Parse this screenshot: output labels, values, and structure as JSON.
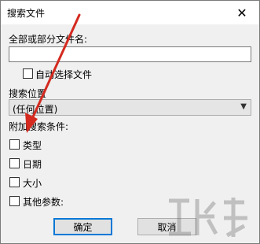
{
  "window": {
    "title": "搜索文件",
    "close_glyph": "✕"
  },
  "name_label": "全部或部分文件名:",
  "name_value": "",
  "auto_select_label": "自动选择文件",
  "location_label": "搜索位置",
  "location_value": "(任何位置)",
  "extra_label": "附加搜索条件:",
  "criteria": [
    "类型",
    "日期",
    "大小",
    "其他参数:"
  ],
  "buttons": {
    "ok": "确定",
    "cancel": "取消"
  },
  "colors": {
    "annotation_arrow": "#d42a1f",
    "default_button_border": "#0078d7"
  }
}
